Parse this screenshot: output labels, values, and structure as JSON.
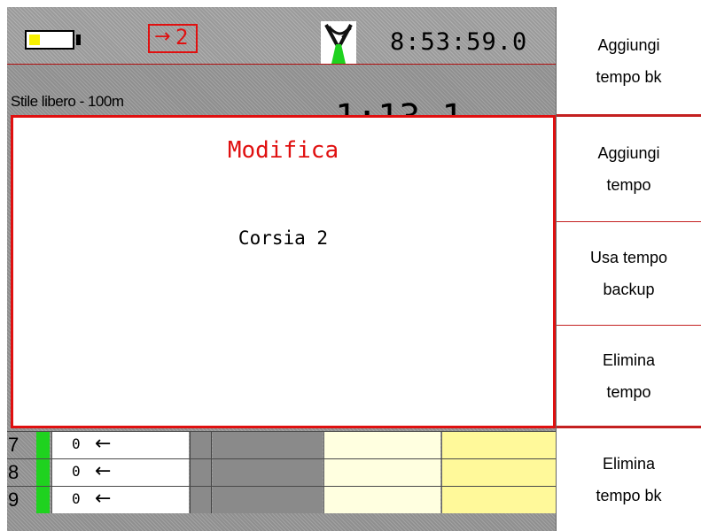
{
  "status": {
    "lane_indicator": "2",
    "clock": "8:53:59.0",
    "battery_level": 0.25,
    "colors": {
      "alert_red": "#e01010",
      "battery": "#f7f000",
      "status_ok": "#1fd21f"
    }
  },
  "event": {
    "title": "Stile libero - 100m",
    "time": "1:13.1"
  },
  "lanes": [
    {
      "number": "7",
      "count": "0",
      "direction": "←"
    },
    {
      "number": "8",
      "count": "0",
      "direction": "←"
    },
    {
      "number": "9",
      "count": "0",
      "direction": "←"
    }
  ],
  "dialog": {
    "title": "Modifica",
    "lane_label": "Corsia 2"
  },
  "softkeys": [
    {
      "line1": "Aggiungi",
      "line2": "tempo bk"
    },
    {
      "line1": "Aggiungi",
      "line2": "tempo"
    },
    {
      "line1": "Usa tempo",
      "line2": "backup"
    },
    {
      "line1": "Elimina",
      "line2": "tempo"
    },
    {
      "line1": "Elimina",
      "line2": "tempo bk"
    }
  ],
  "icons": {
    "battery": "battery-icon",
    "lane_arrow": "lane-entry-arrow-icon",
    "satellite": "satellite-dish-icon"
  }
}
